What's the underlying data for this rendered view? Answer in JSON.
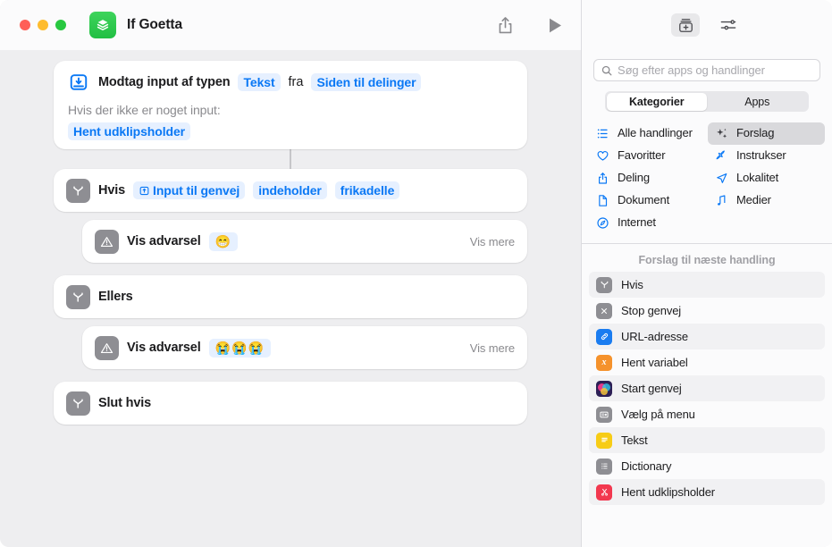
{
  "window": {
    "title": "If Goetta",
    "app_icon": "shortcuts-icon",
    "traffic_lights": [
      "close",
      "minimize",
      "zoom"
    ],
    "accent_blue": "#0a78f5",
    "token_bg": "#e6f0ff",
    "app_icon_green": "#2ec04a"
  },
  "toolbar": {
    "share_label": "share-icon",
    "run_label": "play-icon"
  },
  "workflow": {
    "actions": [
      {
        "id": "receive-input",
        "icon": "receive-input-icon",
        "label": "Modtag input af typen",
        "token_type": "Tekst",
        "connector_word": "fra",
        "token_source": "Siden til delinger",
        "sub_label": "Hvis der ikke er noget input:",
        "sub_token": "Hent udklipsholder"
      },
      {
        "id": "if",
        "icon": "if-icon",
        "label": "Hvis",
        "token_variable": "Input til genvej",
        "token_condition": "indeholder",
        "token_value": "frikadelle"
      },
      {
        "id": "show-alert-if",
        "icon": "alert-icon",
        "label": "Vis advarsel",
        "token_emoji": "😁",
        "show_more": "Vis mere",
        "indented": true
      },
      {
        "id": "otherwise",
        "icon": "if-icon",
        "label": "Ellers"
      },
      {
        "id": "show-alert-else",
        "icon": "alert-icon",
        "label": "Vis advarsel",
        "token_emoji": "😭😭😭",
        "show_more": "Vis mere",
        "indented": true
      },
      {
        "id": "end-if",
        "icon": "if-icon",
        "label": "Slut hvis"
      }
    ]
  },
  "sidebar": {
    "toolbar": {
      "library_icon": "action-library-icon",
      "settings_icon": "sliders-icon"
    },
    "search": {
      "placeholder": "Søg efter apps og handlinger",
      "value": "",
      "icon": "search-icon"
    },
    "segments": [
      {
        "label": "Kategorier",
        "selected": true
      },
      {
        "label": "Apps",
        "selected": false
      }
    ],
    "categories": [
      {
        "label": "Alle handlinger",
        "icon": "list-bullet-icon",
        "selected": false
      },
      {
        "label": "Forslag",
        "icon": "sparkles-icon",
        "selected": true
      },
      {
        "label": "Favoritter",
        "icon": "heart-icon",
        "selected": false
      },
      {
        "label": "Instrukser",
        "icon": "scripting-icon",
        "selected": false
      },
      {
        "label": "Deling",
        "icon": "share-icon",
        "selected": false
      },
      {
        "label": "Lokalitet",
        "icon": "location-arrow-icon",
        "selected": false
      },
      {
        "label": "Dokument",
        "icon": "document-icon",
        "selected": false
      },
      {
        "label": "Medier",
        "icon": "music-note-icon",
        "selected": false
      },
      {
        "label": "Internet",
        "icon": "safari-compass-icon",
        "selected": false
      }
    ],
    "suggestions_header": "Forslag til næste handling",
    "suggestions": [
      {
        "label": "Hvis",
        "icon": "if-icon",
        "color": "#8e8e93"
      },
      {
        "label": "Stop genvej",
        "icon": "stop-icon",
        "color": "#8e8e93"
      },
      {
        "label": "URL-adresse",
        "icon": "link-icon",
        "color": "#1a7cf0"
      },
      {
        "label": "Hent variabel",
        "icon": "variable-icon",
        "color": "#f5922c"
      },
      {
        "label": "Start genvej",
        "icon": "shortcuts-app-icon",
        "color": "#3b2a6b"
      },
      {
        "label": "Vælg på menu",
        "icon": "menu-icon",
        "color": "#8e8e93"
      },
      {
        "label": "Tekst",
        "icon": "text-icon",
        "color": "#f7cc16"
      },
      {
        "label": "Dictionary",
        "icon": "dictionary-icon",
        "color": "#8e8e93"
      },
      {
        "label": "Hent udklipsholder",
        "icon": "clipboard-scissors-icon",
        "color": "#f2384f"
      }
    ]
  }
}
